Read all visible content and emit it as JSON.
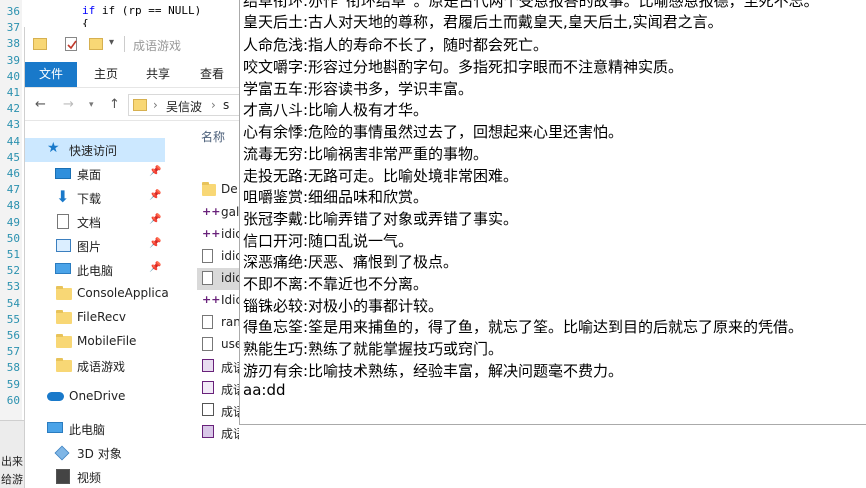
{
  "editor": {
    "line_numbers": [
      "36",
      "37",
      "38",
      "39",
      "40",
      "41",
      "42",
      "43",
      "44",
      "45",
      "46",
      "47",
      "48",
      "49",
      "50",
      "51",
      "52",
      "53",
      "54",
      "55",
      "56",
      "57",
      "58",
      "59",
      "60"
    ],
    "code_if": "if (rp == NULL)",
    "code_brace": "{"
  },
  "console": {
    "lines": [
      "出来",
      "给游"
    ]
  },
  "explorer": {
    "title": "成语游戏",
    "ribbon_tabs": [
      "文件",
      "主页",
      "共享",
      "查看"
    ],
    "address_segments": [
      "吴信波",
      "s"
    ],
    "nav_items": [
      {
        "label": "快速访问",
        "icon": "star-icon"
      },
      {
        "label": "桌面",
        "icon": "desktop-icon",
        "pinned": true
      },
      {
        "label": "下载",
        "icon": "download-icon",
        "pinned": true
      },
      {
        "label": "文档",
        "icon": "document-icon",
        "pinned": true
      },
      {
        "label": "图片",
        "icon": "picture-icon",
        "pinned": true
      },
      {
        "label": "此电脑",
        "icon": "computer-icon",
        "pinned": true
      },
      {
        "label": "ConsoleApplica",
        "icon": "folder-icon"
      },
      {
        "label": "FileRecv",
        "icon": "folder-icon"
      },
      {
        "label": "MobileFile",
        "icon": "folder-icon"
      },
      {
        "label": "成语游戏",
        "icon": "folder-icon"
      },
      {
        "label": "OneDrive",
        "icon": "cloud-icon"
      },
      {
        "label": "此电脑",
        "icon": "computer-icon"
      },
      {
        "label": "3D 对象",
        "icon": "cube-icon"
      },
      {
        "label": "视频",
        "icon": "video-icon"
      }
    ],
    "column_header": "名称",
    "files": [
      {
        "name": "De",
        "icon": "folder-icon"
      },
      {
        "name": "gal",
        "icon": "cpp-file-icon"
      },
      {
        "name": "idic",
        "icon": "cpp-file-icon"
      },
      {
        "name": "idic",
        "icon": "header-file-icon"
      },
      {
        "name": "idic",
        "icon": "text-file-icon"
      },
      {
        "name": "Idic",
        "icon": "cpp-file-icon"
      },
      {
        "name": "ran",
        "icon": "text-file-icon"
      },
      {
        "name": "use",
        "icon": "text-file-icon"
      },
      {
        "name": "成语",
        "icon": "project-file-icon"
      },
      {
        "name": "成语",
        "icon": "filter-file-icon"
      },
      {
        "name": "成语",
        "icon": "user-file-icon"
      },
      {
        "name": "成语",
        "icon": "solution-file-icon"
      }
    ]
  },
  "viewer": {
    "lines": [
      "结草衔环:亦作“衔环结草”。原是古代两个受恩报答的故事。比喻感恩报德，至死不忘。",
      "皇天后土:古人对天地的尊称，君履后土而戴皇天,皇天后土,实闻君之言。",
      "人命危浅:指人的寿命不长了，随时都会死亡。",
      "咬文嚼字:形容过分地斟酌字句。多指死扣字眼而不注意精神实质。",
      "学富五车:形容读书多，学识丰富。",
      "才高八斗:比喻人极有才华。",
      "心有余悸:危险的事情虽然过去了，回想起来心里还害怕。",
      "流毒无穷:比喻祸害非常严重的事物。",
      "走投无路:无路可走。比喻处境非常困难。",
      "咀嚼鉴赏:细细品味和欣赏。",
      "张冠李戴:比喻弄错了对象或弄错了事实。",
      "信口开河:随口乱说一气。",
      "深恶痛绝:厌恶、痛恨到了极点。",
      "不即不离:不靠近也不分离。",
      "锱铢必较:对极小的事都计较。",
      "得鱼忘筌:筌是用来捕鱼的，得了鱼，就忘了筌。比喻达到目的后就忘了原来的凭借。",
      "熟能生巧:熟练了就能掌握技巧或窍门。",
      "游刃有余:比喻技术熟练，经验丰富，解决问题毫不费力。",
      "aa:dd"
    ]
  }
}
